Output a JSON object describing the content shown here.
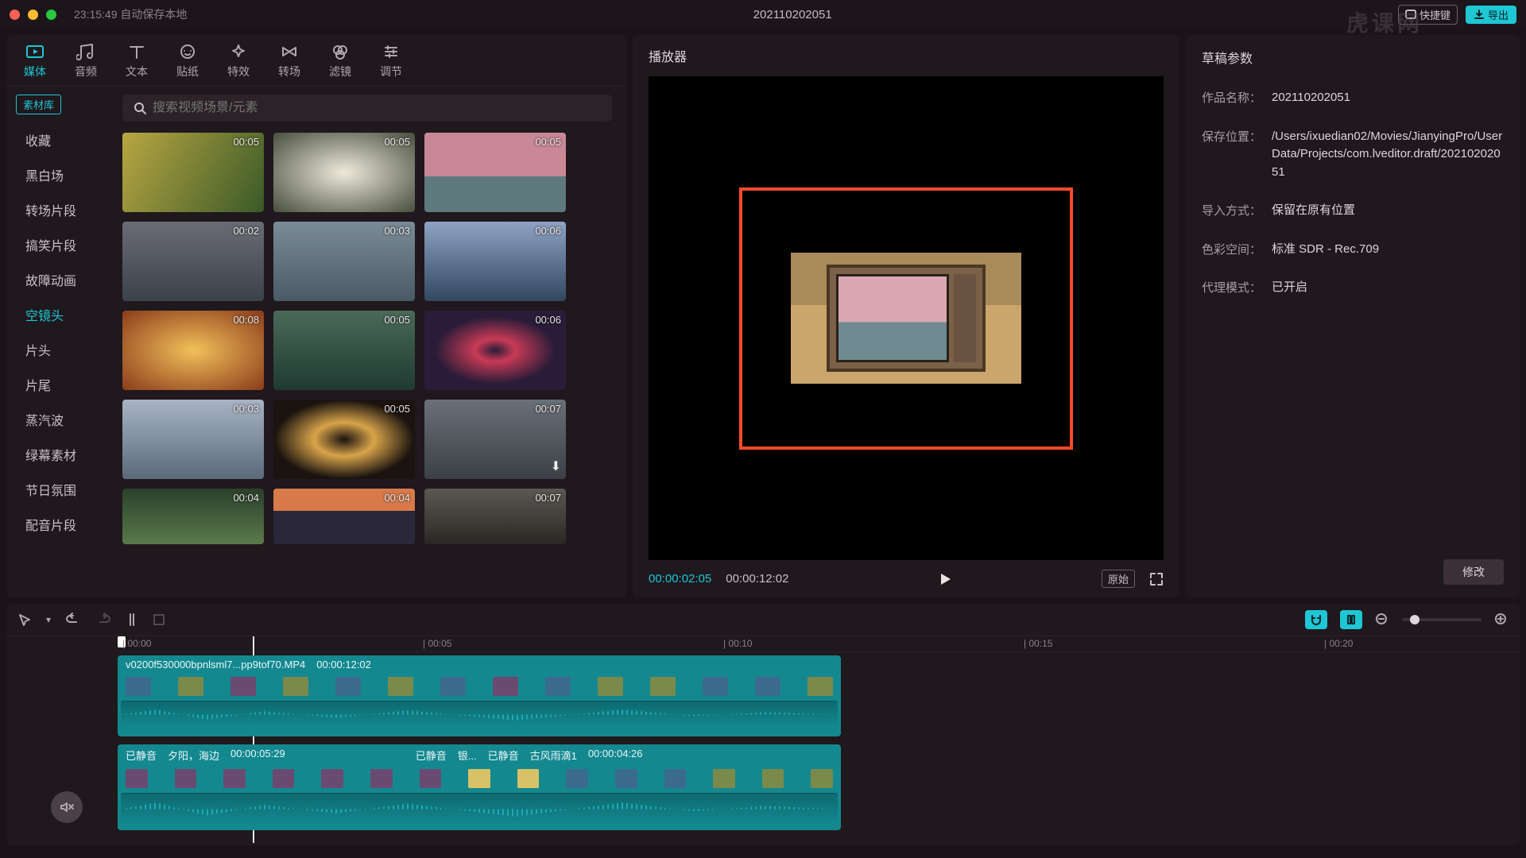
{
  "titlebar": {
    "autosave": "23:15:49 自动保存本地",
    "document": "202110202051",
    "shortcut_label": "快捷键",
    "export_label": "导出",
    "watermark": "虎课网"
  },
  "tool_tabs": [
    {
      "label": "媒体",
      "icon": "video-play-icon",
      "active": true
    },
    {
      "label": "音频",
      "icon": "audio-icon",
      "active": false
    },
    {
      "label": "文本",
      "icon": "text-icon",
      "active": false
    },
    {
      "label": "贴纸",
      "icon": "sticker-icon",
      "active": false
    },
    {
      "label": "特效",
      "icon": "sparkle-icon",
      "active": false
    },
    {
      "label": "转场",
      "icon": "transition-icon",
      "active": false
    },
    {
      "label": "滤镜",
      "icon": "filter-icon",
      "active": false
    },
    {
      "label": "调节",
      "icon": "adjust-icon",
      "active": false
    }
  ],
  "side_library_badge": "素材库",
  "categories": [
    {
      "label": "收藏",
      "active": false
    },
    {
      "label": "黑白场",
      "active": false
    },
    {
      "label": "转场片段",
      "active": false
    },
    {
      "label": "搞笑片段",
      "active": false
    },
    {
      "label": "故障动画",
      "active": false
    },
    {
      "label": "空镜头",
      "active": true
    },
    {
      "label": "片头",
      "active": false
    },
    {
      "label": "片尾",
      "active": false
    },
    {
      "label": "蒸汽波",
      "active": false
    },
    {
      "label": "绿幕素材",
      "active": false
    },
    {
      "label": "节日氛围",
      "active": false
    },
    {
      "label": "配音片段",
      "active": false
    }
  ],
  "search": {
    "placeholder": "搜索视频场景/元素"
  },
  "clips": [
    {
      "duration": "00:05"
    },
    {
      "duration": "00:05"
    },
    {
      "duration": "00:05"
    },
    {
      "duration": "00:02"
    },
    {
      "duration": "00:03"
    },
    {
      "duration": "00:06"
    },
    {
      "duration": "00:08"
    },
    {
      "duration": "00:05"
    },
    {
      "duration": "00:06"
    },
    {
      "duration": "00:03"
    },
    {
      "duration": "00:05"
    },
    {
      "duration": "00:07"
    },
    {
      "duration": "00:04"
    },
    {
      "duration": "00:04"
    },
    {
      "duration": "00:07"
    }
  ],
  "clip_bgs": [
    "linear-gradient(120deg,#b8a642,#3a5a28)",
    "radial-gradient(#eeeadc,#474d3d)",
    "linear-gradient(#c98896 55%,#5f7a7e 55%)",
    "linear-gradient(#6a6c74,#3b424a)",
    "linear-gradient(#7a8c98,#4a5a64)",
    "linear-gradient(#8fa2c4,#32475f)",
    "radial-gradient(#f2c05a,#8a3b1a)",
    "linear-gradient(#4a6a58,#1f3a32)",
    "radial-gradient(#2a1c38,#c83a56 20%,#2a1c38 60%)",
    "linear-gradient(#a8b4c4,#5a6a78)",
    "radial-gradient(#1a130f,#d8a44a 30%,#1a130f 70%)",
    "linear-gradient(#6a7078,#3a4044)",
    "linear-gradient(#2a402a,#5a7a4a)",
    "linear-gradient(#d87a4a 40%,#2a2838 40%)",
    "linear-gradient(#5a5850,#2a2824)"
  ],
  "player": {
    "title": "播放器",
    "current": "00:00:02:05",
    "total": "00:00:12:02",
    "original_label": "原始"
  },
  "draft": {
    "title": "草稿参数",
    "props": [
      {
        "label": "作品名称：",
        "value": "202110202051"
      },
      {
        "label": "保存位置：",
        "value": "/Users/ixuedian02/Movies/JianyingPro/User Data/Projects/com.lveditor.draft/20210202051"
      },
      {
        "label": "导入方式：",
        "value": "保留在原有位置"
      },
      {
        "label": "色彩空间：",
        "value": "标准 SDR - Rec.709"
      },
      {
        "label": "代理模式：",
        "value": "已开启"
      }
    ],
    "modify_label": "修改"
  },
  "ruler_ticks": [
    {
      "label": "00:00",
      "pos": 6
    },
    {
      "label": "00:05",
      "pos": 384
    },
    {
      "label": "00:10",
      "pos": 762
    },
    {
      "label": "00:15",
      "pos": 1140
    },
    {
      "label": "00:20",
      "pos": 1518
    }
  ],
  "tracks": {
    "t1": {
      "filename": "v0200f530000bpnlsml7...pp9tof70.MP4",
      "duration": "00:00:12:02"
    },
    "t2": {
      "seg1_muted": "已静音",
      "seg1_name": "夕阳，海边",
      "seg1_dur": "00:00:05:29",
      "seg2_muted": "已静音",
      "seg2_short": "银...",
      "seg3_muted": "已静音",
      "seg3_name": "古风雨滴1",
      "seg3_dur": "00:00:04:26"
    }
  }
}
